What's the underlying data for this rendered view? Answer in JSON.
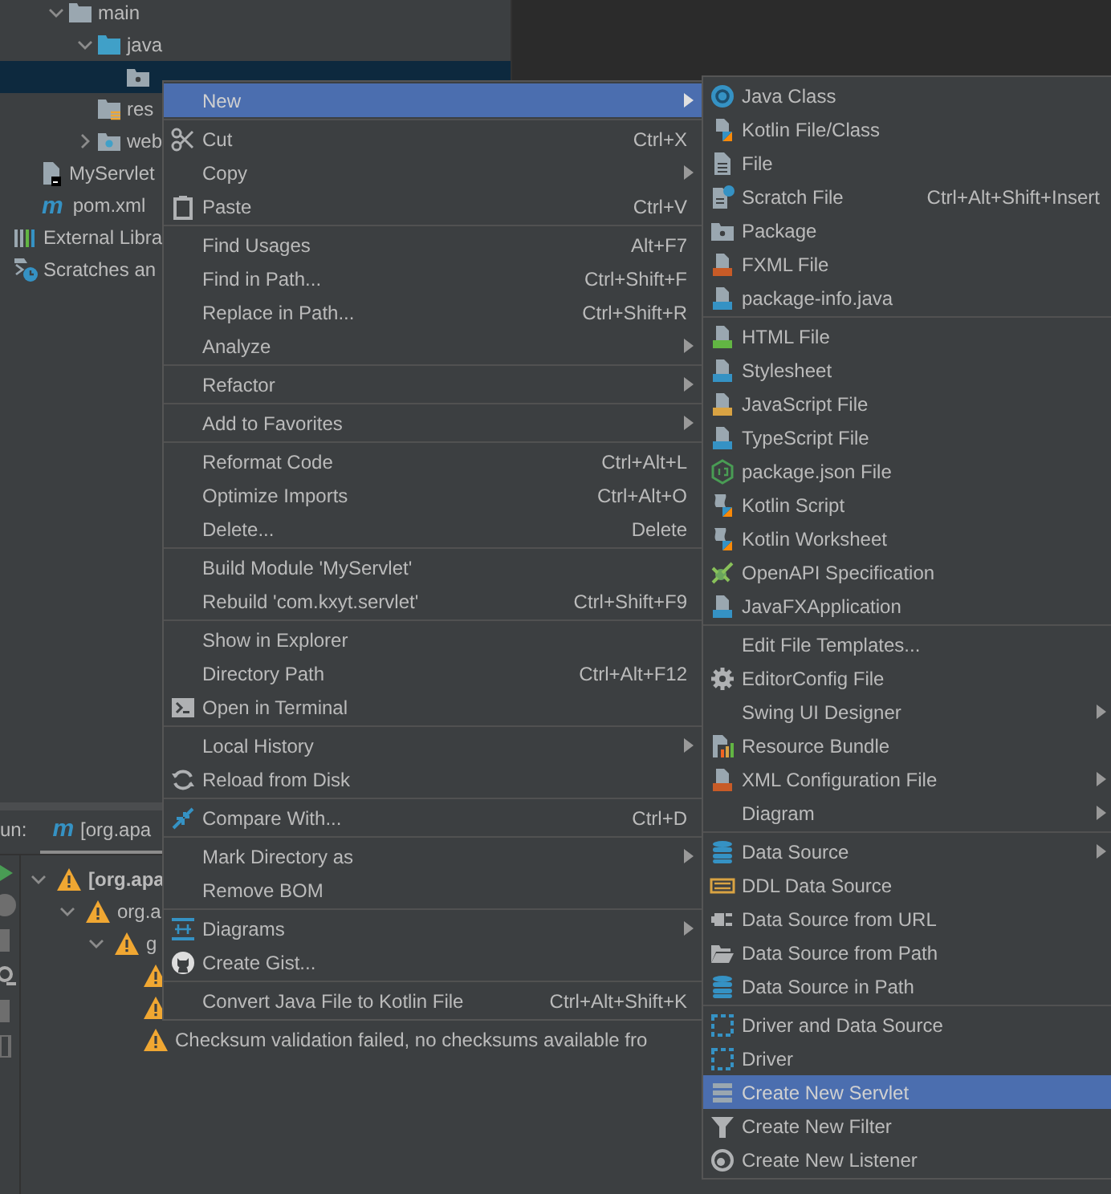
{
  "project_tree": {
    "items": [
      {
        "label": "main",
        "selected": false,
        "expanded": true,
        "children": [
          {
            "label": "java",
            "selected": false,
            "expanded": true,
            "children": [
              {
                "selected": true
              }
            ]
          },
          {
            "label": "res",
            "selected": false
          },
          {
            "label": "web",
            "selected": false,
            "expanded": false
          }
        ]
      }
    ],
    "module_items": [
      {
        "label": "MyServlet",
        "selected": false
      },
      {
        "label": "pom.xml",
        "icon_text": "m",
        "selected": false
      }
    ],
    "root_items": [
      {
        "label": "External Libra",
        "selected": false
      },
      {
        "label": "Scratches an",
        "selected": false
      }
    ]
  },
  "run_panel": {
    "title": "un:",
    "tabs": [
      {
        "icon_text": "m",
        "label": "[org.apa",
        "selected": true
      }
    ],
    "tree": [
      {
        "label": "[org.apa",
        "kind": "warning",
        "expanded": true,
        "children": [
          {
            "label": "org.a",
            "kind": "warning",
            "expanded": true,
            "children": [
              {
                "label": "g",
                "kind": "warning",
                "expanded": true,
                "children": [
                  {
                    "kind": "warning"
                  },
                  {
                    "kind": "warning"
                  },
                  {
                    "label": "Checksum validation failed, no checksums available fro",
                    "kind": "warning"
                  }
                ]
              }
            ]
          }
        ]
      }
    ]
  },
  "context_menu": {
    "groups": [
      [
        {
          "label": "New",
          "submenu": true,
          "selected": true
        }
      ],
      [
        {
          "label": "Cut",
          "shortcut": "Ctrl+X",
          "submenu": false,
          "selected": false
        },
        {
          "label": "Copy",
          "submenu": true,
          "selected": false
        },
        {
          "label": "Paste",
          "shortcut": "Ctrl+V",
          "submenu": false,
          "selected": false
        }
      ],
      [
        {
          "label": "Find Usages",
          "shortcut": "Alt+F7",
          "submenu": false,
          "selected": false
        },
        {
          "label": "Find in Path...",
          "shortcut": "Ctrl+Shift+F",
          "submenu": false,
          "selected": false
        },
        {
          "label": "Replace in Path...",
          "shortcut": "Ctrl+Shift+R",
          "submenu": false,
          "selected": false
        },
        {
          "label": "Analyze",
          "submenu": true,
          "selected": false
        }
      ],
      [
        {
          "label": "Refactor",
          "submenu": true,
          "selected": false
        }
      ],
      [
        {
          "label": "Add to Favorites",
          "submenu": true,
          "selected": false
        }
      ],
      [
        {
          "label": "Reformat Code",
          "shortcut": "Ctrl+Alt+L",
          "submenu": false,
          "selected": false
        },
        {
          "label": "Optimize Imports",
          "shortcut": "Ctrl+Alt+O",
          "submenu": false,
          "selected": false
        },
        {
          "label": "Delete...",
          "shortcut": "Delete",
          "submenu": false,
          "selected": false
        }
      ],
      [
        {
          "label": "Build Module 'MyServlet'",
          "submenu": false,
          "selected": false
        },
        {
          "label": "Rebuild 'com.kxyt.servlet'",
          "shortcut": "Ctrl+Shift+F9",
          "submenu": false,
          "selected": false
        }
      ],
      [
        {
          "label": "Show in Explorer",
          "submenu": false,
          "selected": false
        },
        {
          "label": "Directory Path",
          "shortcut": "Ctrl+Alt+F12",
          "submenu": false,
          "selected": false
        },
        {
          "label": "Open in Terminal",
          "submenu": false,
          "selected": false
        }
      ],
      [
        {
          "label": "Local History",
          "submenu": true,
          "selected": false
        },
        {
          "label": "Reload from Disk",
          "submenu": false,
          "selected": false
        }
      ],
      [
        {
          "label": "Compare With...",
          "shortcut": "Ctrl+D",
          "submenu": false,
          "selected": false
        }
      ],
      [
        {
          "label": "Mark Directory as",
          "submenu": true,
          "selected": false
        },
        {
          "label": "Remove BOM",
          "submenu": false,
          "selected": false
        }
      ],
      [
        {
          "label": "Diagrams",
          "submenu": true,
          "selected": false
        },
        {
          "label": "Create Gist...",
          "submenu": false,
          "selected": false
        }
      ],
      [
        {
          "label": "Convert Java File to Kotlin File",
          "shortcut": "Ctrl+Alt+Shift+K",
          "submenu": false,
          "selected": false
        }
      ]
    ]
  },
  "new_submenu": {
    "groups": [
      [
        {
          "label": "Java Class",
          "submenu": false,
          "selected": false
        },
        {
          "label": "Kotlin File/Class",
          "submenu": false,
          "selected": false
        },
        {
          "label": "File",
          "submenu": false,
          "selected": false
        },
        {
          "label": "Scratch File",
          "shortcut": "Ctrl+Alt+Shift+Insert",
          "submenu": false,
          "selected": false
        },
        {
          "label": "Package",
          "submenu": false,
          "selected": false
        },
        {
          "label": "FXML File",
          "submenu": false,
          "selected": false
        },
        {
          "label": "package-info.java",
          "submenu": false,
          "selected": false
        }
      ],
      [
        {
          "label": "HTML File",
          "submenu": false,
          "selected": false
        },
        {
          "label": "Stylesheet",
          "submenu": false,
          "selected": false
        },
        {
          "label": "JavaScript File",
          "submenu": false,
          "selected": false
        },
        {
          "label": "TypeScript File",
          "submenu": false,
          "selected": false
        },
        {
          "label": "package.json File",
          "submenu": false,
          "selected": false
        },
        {
          "label": "Kotlin Script",
          "submenu": false,
          "selected": false
        },
        {
          "label": "Kotlin Worksheet",
          "submenu": false,
          "selected": false
        },
        {
          "label": "OpenAPI Specification",
          "submenu": false,
          "selected": false
        },
        {
          "label": "JavaFXApplication",
          "submenu": false,
          "selected": false
        }
      ],
      [
        {
          "label": "Edit File Templates...",
          "submenu": false,
          "selected": false
        },
        {
          "label": "EditorConfig File",
          "submenu": false,
          "selected": false
        },
        {
          "label": "Swing UI Designer",
          "submenu": true,
          "selected": false
        },
        {
          "label": "Resource Bundle",
          "submenu": false,
          "selected": false
        },
        {
          "label": "XML Configuration File",
          "submenu": true,
          "selected": false
        },
        {
          "label": "Diagram",
          "submenu": true,
          "selected": false
        }
      ],
      [
        {
          "label": "Data Source",
          "submenu": true,
          "selected": false
        },
        {
          "label": "DDL Data Source",
          "submenu": false,
          "selected": false
        },
        {
          "label": "Data Source from URL",
          "submenu": false,
          "selected": false
        },
        {
          "label": "Data Source from Path",
          "submenu": false,
          "selected": false
        },
        {
          "label": "Data Source in Path",
          "submenu": false,
          "selected": false
        }
      ],
      [
        {
          "label": "Driver and Data Source",
          "submenu": false,
          "selected": false
        },
        {
          "label": "Driver",
          "submenu": false,
          "selected": false
        },
        {
          "label": "Create New Servlet",
          "submenu": false,
          "selected": true
        },
        {
          "label": "Create New Filter",
          "submenu": false,
          "selected": false
        },
        {
          "label": "Create New Listener",
          "submenu": false,
          "selected": false
        }
      ]
    ]
  }
}
